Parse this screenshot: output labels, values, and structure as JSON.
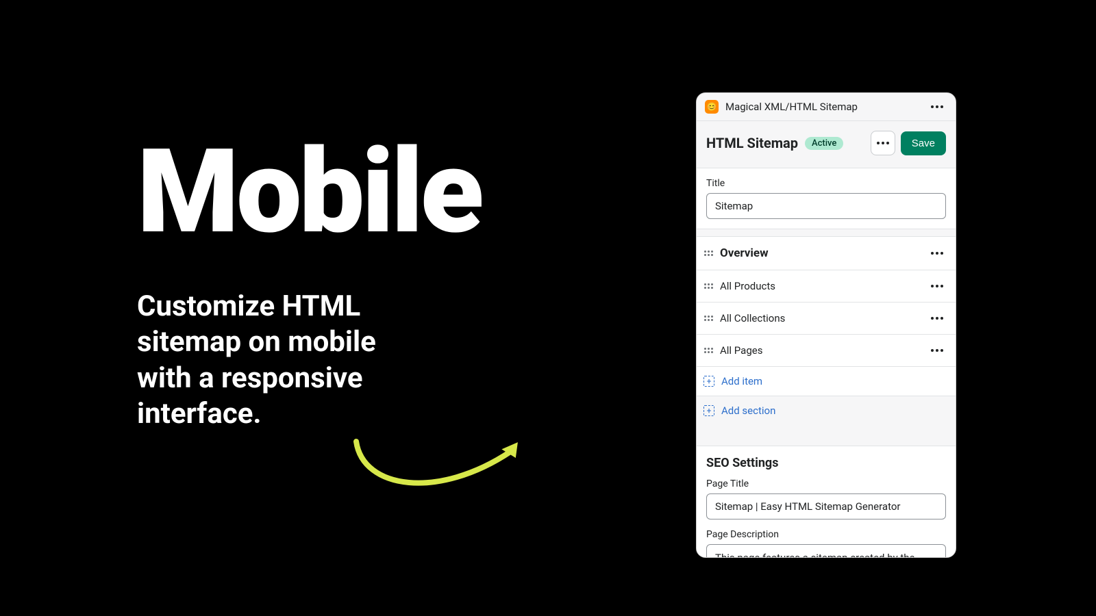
{
  "marketing": {
    "heading": "Mobile",
    "subheading": "Customize HTML sitemap on mobile with a responsive interface."
  },
  "window": {
    "app_name": "Magical XML/HTML Sitemap",
    "app_icon": "😊"
  },
  "header": {
    "title": "HTML Sitemap",
    "status_label": "Active",
    "more_name": "more-actions",
    "save_label": "Save"
  },
  "title_field": {
    "label": "Title",
    "value": "Sitemap"
  },
  "section": {
    "heading": "Overview",
    "items": [
      {
        "label": "All Products"
      },
      {
        "label": "All Collections"
      },
      {
        "label": "All Pages"
      }
    ],
    "add_item_label": "Add item",
    "add_section_label": "Add section"
  },
  "seo": {
    "heading": "SEO Settings",
    "page_title_label": "Page Title",
    "page_title_value": "Sitemap | Easy HTML Sitemap Generator",
    "page_description_label": "Page Description",
    "page_description_value": "This page features a sitemap created by the Easy HTML Sitemap Generator app for Shopify."
  }
}
